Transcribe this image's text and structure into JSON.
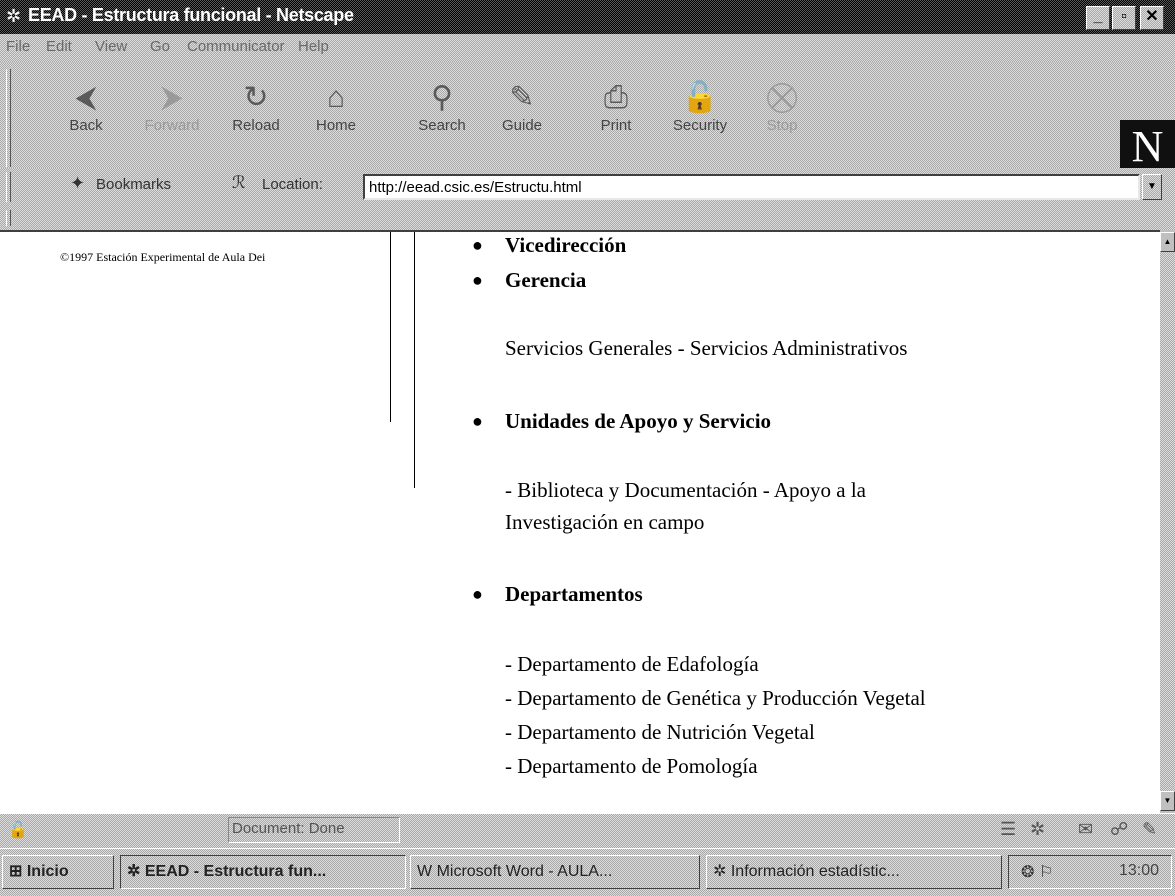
{
  "window": {
    "title": "EEAD - Estructura funcional - Netscape",
    "icon": "netscape-window-icon",
    "controls": [
      "minimize",
      "maximize",
      "close"
    ]
  },
  "menu": [
    "File",
    "Edit",
    "View",
    "Go",
    "Communicator",
    "Help"
  ],
  "toolbar": {
    "buttons": [
      {
        "label": "Back",
        "icon": "back-arrow-icon",
        "enabled": true
      },
      {
        "label": "Forward",
        "icon": "forward-arrow-icon",
        "enabled": false
      },
      {
        "label": "Reload",
        "icon": "reload-icon",
        "enabled": true
      },
      {
        "label": "Home",
        "icon": "home-icon",
        "enabled": true
      },
      {
        "label": "Search",
        "icon": "search-icon",
        "enabled": true
      },
      {
        "label": "Guide",
        "icon": "guide-icon",
        "enabled": true
      },
      {
        "label": "Print",
        "icon": "print-icon",
        "enabled": true
      },
      {
        "label": "Security",
        "icon": "security-lock-icon",
        "enabled": true
      },
      {
        "label": "Stop",
        "icon": "stop-icon",
        "enabled": false
      }
    ],
    "logo": "N"
  },
  "location_bar": {
    "bookmarks_label": "Bookmarks",
    "location_label": "Location:",
    "url": "http://eead.csic.es/Estructu.html"
  },
  "content": {
    "copyright": "©1997 Estación Experimental de Aula Dei",
    "sections": [
      {
        "heading": "Vicedirección"
      },
      {
        "heading": "Gerencia",
        "lines": [
          "Servicios Generales - Servicios Administrativos"
        ]
      },
      {
        "heading": "Unidades de Apoyo y Servicio",
        "lines": [
          "- Biblioteca y Documentación - Apoyo a la",
          "Investigación en campo"
        ]
      },
      {
        "heading": "Departamentos",
        "lines": [
          "- Departamento de Edafología",
          "- Departamento de Genética y Producción Vegetal",
          "- Departamento de Nutrición Vegetal",
          "- Departamento de Pomología"
        ]
      }
    ]
  },
  "status": {
    "text": "Document: Done"
  },
  "taskbar": {
    "start_label": "Inicio",
    "tasks": [
      {
        "label": "EEAD - Estructura fun...",
        "active": true
      },
      {
        "label": "Microsoft Word - AULA...",
        "active": false
      },
      {
        "label": "Información estadístic...",
        "active": false
      }
    ],
    "clock": "13:00"
  }
}
